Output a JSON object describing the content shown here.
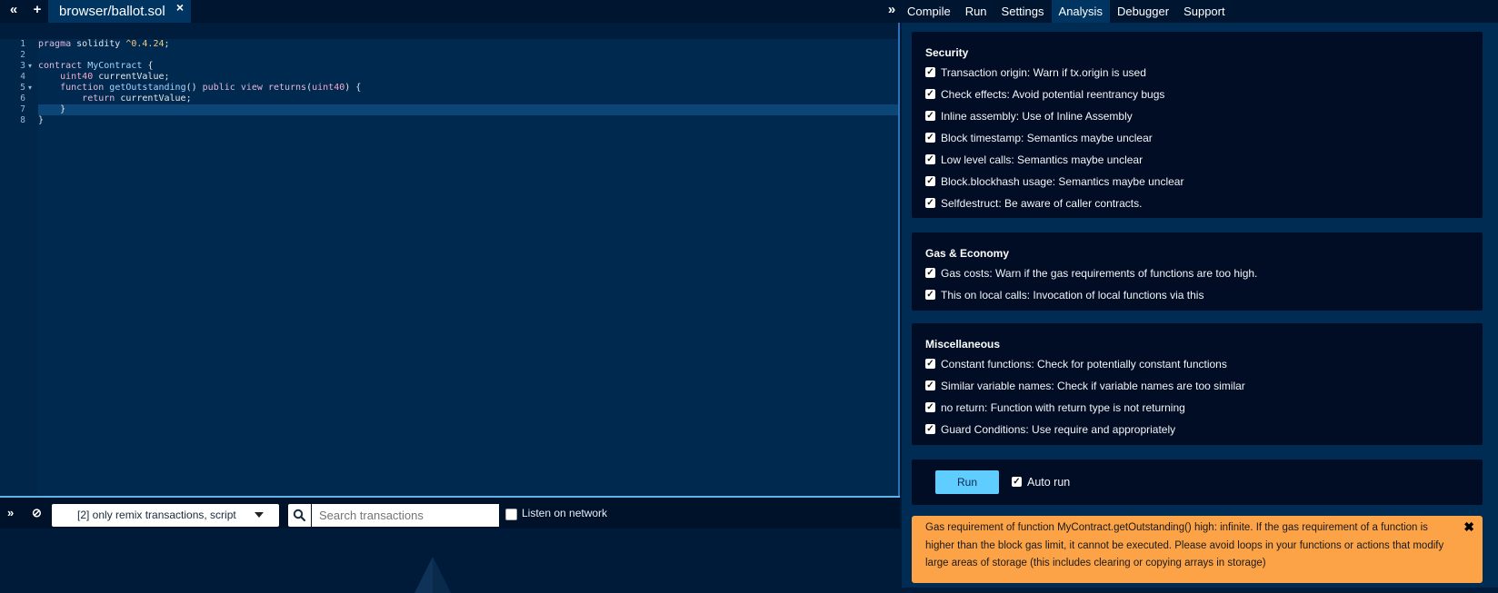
{
  "topbar": {
    "collapse_icon": "«",
    "add_icon": "+",
    "file_tab": "browser/ballot.sol",
    "close_icon": "×",
    "panel_toggle_icon": "»"
  },
  "tabs": [
    "Compile",
    "Run",
    "Settings",
    "Analysis",
    "Debugger",
    "Support"
  ],
  "active_tab": "Analysis",
  "editor": {
    "line_numbers": [
      "1",
      "2",
      "3",
      "4",
      "5",
      "6",
      "7",
      "8"
    ],
    "fold_markers": [
      "▾",
      "▾"
    ]
  },
  "terminal": {
    "collapse_icon": "»",
    "clear_icon": "⊘",
    "filter_value": "[2] only remix transactions, script",
    "search_placeholder": "Search transactions",
    "listen_label": "Listen on network"
  },
  "analysis": {
    "security": {
      "title": "Security",
      "items": [
        "Transaction origin: Warn if tx.origin is used",
        "Check effects: Avoid potential reentrancy bugs",
        "Inline assembly: Use of Inline Assembly",
        "Block timestamp: Semantics maybe unclear",
        "Low level calls: Semantics maybe unclear",
        "Block.blockhash usage: Semantics maybe unclear",
        "Selfdestruct: Be aware of caller contracts."
      ]
    },
    "gas": {
      "title": "Gas & Economy",
      "items": [
        "Gas costs: Warn if the gas requirements of functions are too high.",
        "This on local calls: Invocation of local functions via this"
      ]
    },
    "misc": {
      "title": "Miscellaneous",
      "items": [
        "Constant functions: Check for potentially constant functions",
        "Similar variable names: Check if variable names are too similar",
        "no return: Function with return type is not returning",
        "Guard Conditions: Use require and appropriately"
      ]
    },
    "run_label": "Run",
    "auto_run_label": "Auto run",
    "check_mark": "✓",
    "warning": "Gas requirement of function MyContract.getOutstanding() high: infinite. If the gas requirement of a function is higher than the block gas limit, it cannot be executed. Please avoid loops in your functions or actions that modify large areas of storage (this includes clearing or copying arrays in storage)",
    "warning_close": "✖"
  }
}
